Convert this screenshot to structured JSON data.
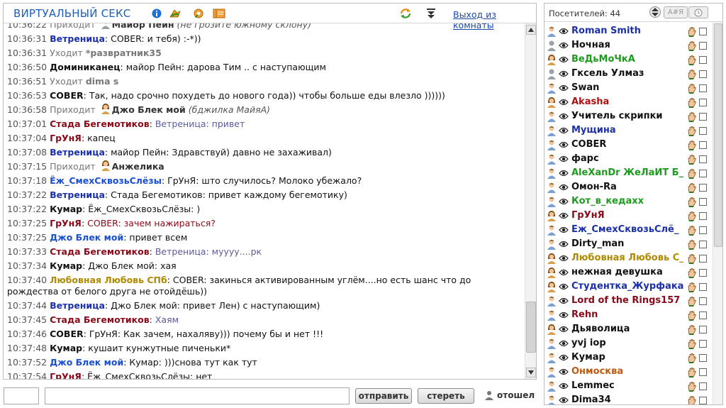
{
  "chat": {
    "title": "ВИРТУАЛЬНЫЙ СЕКС",
    "exit_link": "Выход из комнаты",
    "messages": [
      {
        "time": "10:36:22",
        "type": "system",
        "action": "Приходит",
        "nick": "Майор Пейн",
        "note": "(не грозите южному склону)"
      },
      {
        "time": "10:36:31",
        "type": "chat",
        "nick": "Ветреница",
        "nick_color": "#1a2fa8",
        "text": "COBER: и тебя) :-*))"
      },
      {
        "time": "10:36:31",
        "type": "system",
        "action": "Уходит",
        "nick": "*развратник35"
      },
      {
        "time": "10:36:50",
        "type": "chat",
        "nick": "Доминиканец",
        "nick_color": "#111111",
        "text": "майор Пейн: дарова Тим .. с наступающим"
      },
      {
        "time": "10:36:51",
        "type": "system",
        "action": "Уходит",
        "nick": "dima s"
      },
      {
        "time": "10:36:53",
        "type": "chat",
        "nick": "COBER",
        "nick_color": "#111111",
        "text": "Так, надо срочно похудеть до нового года)) чтобы больше еды влезло ))))))"
      },
      {
        "time": "10:36:58",
        "type": "system",
        "action": "Приходит",
        "nick": "Джо Блек мой",
        "note": "(бджилка МайяА)"
      },
      {
        "time": "10:37:01",
        "type": "chat",
        "nick": "Стада Бегемотиков",
        "nick_color": "#8b0a1a",
        "text": "Ветреница: привет",
        "text_color": "#5b5b9a"
      },
      {
        "time": "10:37:04",
        "type": "chat",
        "nick": "ГрУнЯ",
        "nick_color": "#8b0a1a",
        "text": "капец"
      },
      {
        "time": "10:37:08",
        "type": "chat",
        "nick": "Ветреница",
        "nick_color": "#1a2fa8",
        "text": "майор Пейн: Здравствуй) давно не захаживал)"
      },
      {
        "time": "10:37:15",
        "type": "system",
        "action": "Приходит",
        "nick": "Анжелика"
      },
      {
        "time": "10:37:18",
        "type": "chat",
        "nick": "Ёж_СмехСквозьСлёзы",
        "nick_color": "#1a4fd0",
        "text": "ГрУнЯ: што случилось? Молоко убежало?"
      },
      {
        "time": "10:37:22",
        "type": "chat",
        "nick": "Ветреница",
        "nick_color": "#1a2fa8",
        "text": "Стада Бегемотиков: привет каждому бегемотику)"
      },
      {
        "time": "10:37:22",
        "type": "chat",
        "nick": "Кумар",
        "nick_color": "#111111",
        "text": "Ёж_СмехСквозьСлёзы: )"
      },
      {
        "time": "10:37:25",
        "type": "chat",
        "nick": "ГрУнЯ",
        "nick_color": "#8b0a1a",
        "text": "COBER: зачем нажираться?",
        "text_color": "#8b0a1a"
      },
      {
        "time": "10:37:25",
        "type": "chat",
        "nick": "Джо Блек мой",
        "nick_color": "#1a4fd0",
        "text": "привет всем"
      },
      {
        "time": "10:37:33",
        "type": "chat",
        "nick": "Стада Бегемотиков",
        "nick_color": "#8b0a1a",
        "text": "Ветреница: муууу....рк",
        "text_color": "#5b5b9a"
      },
      {
        "time": "10:37:34",
        "type": "chat",
        "nick": "Кумар",
        "nick_color": "#111111",
        "text": "Джо Блек мой: хая"
      },
      {
        "time": "10:37:40",
        "type": "chat",
        "wrap": true,
        "nick": "Любовная Любовь СПб",
        "nick_color": "#b08a00",
        "text": "COBER: закинься активированным углём....но есть шанс что до рождества от белого друга не отойдёшь))"
      },
      {
        "time": "10:37:44",
        "type": "chat",
        "nick": "Ветреница",
        "nick_color": "#1a2fa8",
        "text": "Джо Блек мой: привет Лен) с наступающим)"
      },
      {
        "time": "10:37:45",
        "type": "chat",
        "nick": "Стада Бегемотиков",
        "nick_color": "#8b0a1a",
        "text": "Хаям",
        "text_color": "#5b5b9a"
      },
      {
        "time": "10:37:46",
        "type": "chat",
        "nick": "COBER",
        "nick_color": "#111111",
        "text": "ГрУнЯ: Как зачем, нахаляву))) почему бы и нет !!!"
      },
      {
        "time": "10:37:48",
        "type": "chat",
        "nick": "Кумар",
        "nick_color": "#111111",
        "text": "кушаит кунжутные пиченьки*"
      },
      {
        "time": "10:37:52",
        "type": "chat",
        "nick": "Джо Блек мой",
        "nick_color": "#1a4fd0",
        "text": "Кумар: )))снова тут как тут"
      },
      {
        "time": "10:37:54",
        "type": "chat",
        "nick": "ГрУнЯ",
        "nick_color": "#8b0a1a",
        "text": "Ёж_СмехСквозьСлёзы: нет"
      }
    ]
  },
  "input": {
    "nick_value": "",
    "message_value": "",
    "send_label": "отправить",
    "clear_label": "стереть",
    "away_label": "отошел"
  },
  "users": {
    "visitors_label": "Посетителей: 44",
    "sort_az_label": "А#Я",
    "list": [
      {
        "name": "Roman Smith",
        "color": "#1a2fa8",
        "gender": "m"
      },
      {
        "name": "Ночная",
        "color": "#111111",
        "gender": "n"
      },
      {
        "name": "ВеДьМоЧкА",
        "color": "#1d9b1d",
        "gender": "f"
      },
      {
        "name": "Гксель Улмаз",
        "color": "#111111",
        "gender": "n"
      },
      {
        "name": "Swan",
        "color": "#111111",
        "gender": "m"
      },
      {
        "name": "Akasha",
        "color": "#b01010",
        "gender": "f"
      },
      {
        "name": "Учитель скрипки",
        "color": "#111111",
        "gender": "m"
      },
      {
        "name": "Мущина",
        "color": "#1a2fa8",
        "gender": "m"
      },
      {
        "name": "COBER",
        "color": "#111111",
        "gender": "m"
      },
      {
        "name": "фарс",
        "color": "#111111",
        "gender": "m"
      },
      {
        "name": "AleXanDr ЖеЛаИТ Б_",
        "color": "#1d9b1d",
        "gender": "m"
      },
      {
        "name": "Омон-Ra",
        "color": "#111111",
        "gender": "m"
      },
      {
        "name": "Кот_в_кедахх",
        "color": "#1d9b1d",
        "gender": "m"
      },
      {
        "name": "ГрУнЯ",
        "color": "#8b0a1a",
        "gender": "f"
      },
      {
        "name": "Ёж_СмехСквозьСлё_",
        "color": "#1a2fa8",
        "gender": "m"
      },
      {
        "name": "Dirty_man",
        "color": "#111111",
        "gender": "m"
      },
      {
        "name": "Любовная Любовь С_",
        "color": "#b08a00",
        "gender": "f"
      },
      {
        "name": "нежная девушка",
        "color": "#111111",
        "gender": "f"
      },
      {
        "name": "Студентка_Журфака",
        "color": "#1a2fa8",
        "gender": "f"
      },
      {
        "name": "Lord of the Rings157",
        "color": "#8b0a1a",
        "gender": "m"
      },
      {
        "name": "Rehn",
        "color": "#8b0a1a",
        "gender": "m"
      },
      {
        "name": "Дьяволица",
        "color": "#111111",
        "gender": "f"
      },
      {
        "name": "yvj iop",
        "color": "#111111",
        "gender": "m"
      },
      {
        "name": "Кумар",
        "color": "#111111",
        "gender": "m"
      },
      {
        "name": "Онмосква",
        "color": "#c05a10",
        "gender": "m"
      },
      {
        "name": "Lemmec",
        "color": "#111111",
        "gender": "m"
      },
      {
        "name": "Dima34",
        "color": "#111111",
        "gender": "m"
      }
    ]
  },
  "colors": {
    "title": "#1c5fb8",
    "link": "#1d48a8",
    "border": "#bdbdbd"
  },
  "icons": {
    "header": [
      "info-icon",
      "smiley-icon",
      "settings-icon",
      "notebook-icon",
      "refresh-icon",
      "download-icon"
    ],
    "user_row": [
      "avatar-icon",
      "eye-icon",
      "hand-icon",
      "checkbox"
    ]
  }
}
